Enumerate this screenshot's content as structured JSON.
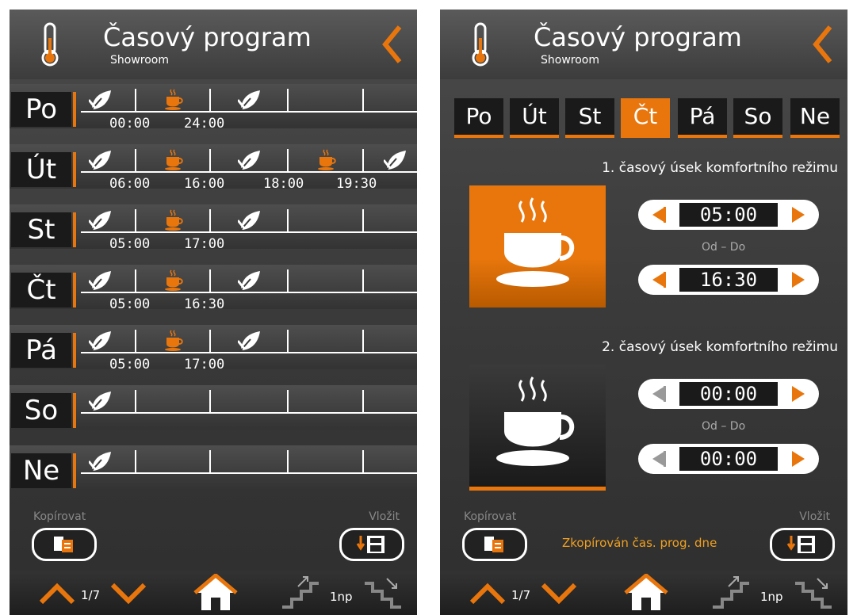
{
  "left": {
    "title": "Časový program",
    "subtitle": "Showroom",
    "rows": [
      {
        "day": "Po",
        "times": [
          "00:00",
          "24:00"
        ]
      },
      {
        "day": "Út",
        "times": [
          "06:00",
          "16:00",
          "18:00",
          "19:30"
        ]
      },
      {
        "day": "St",
        "times": [
          "05:00",
          "17:00"
        ]
      },
      {
        "day": "Čt",
        "times": [
          "05:00",
          "16:30"
        ]
      },
      {
        "day": "Pá",
        "times": [
          "05:00",
          "17:00"
        ]
      },
      {
        "day": "So",
        "times": []
      },
      {
        "day": "Ne",
        "times": []
      }
    ],
    "copy_label": "Kopírovat",
    "paste_label": "Vložit",
    "page": "1/7",
    "floor": "1np"
  },
  "right": {
    "title": "Časový program",
    "subtitle": "Showroom",
    "tabs": [
      "Po",
      "Út",
      "St",
      "Čt",
      "Pá",
      "So",
      "Ne"
    ],
    "active_tab": "Čt",
    "section1_label": "1. časový úsek komfortního režimu",
    "section1_from": "05:00",
    "section1_to": "16:30",
    "section2_label": "2. časový úsek komfortního režimu",
    "section2_from": "00:00",
    "section2_to": "00:00",
    "odo_label": "Od – Do",
    "copy_label": "Kopírovat",
    "paste_label": "Vložit",
    "copied_msg": "Zkopírován čas. prog. dne",
    "page": "1/7",
    "floor": "1np"
  },
  "colors": {
    "accent": "#e8760c",
    "background": "#3a3a3a",
    "message": "#f0a020"
  },
  "icons": [
    "thermometer-icon",
    "back-chevron-icon",
    "leaf-icon",
    "coffee-cup-icon",
    "copy-icon",
    "paste-icon",
    "chevron-up-icon",
    "chevron-down-icon",
    "home-icon",
    "stairs-up-icon",
    "stairs-down-icon"
  ]
}
